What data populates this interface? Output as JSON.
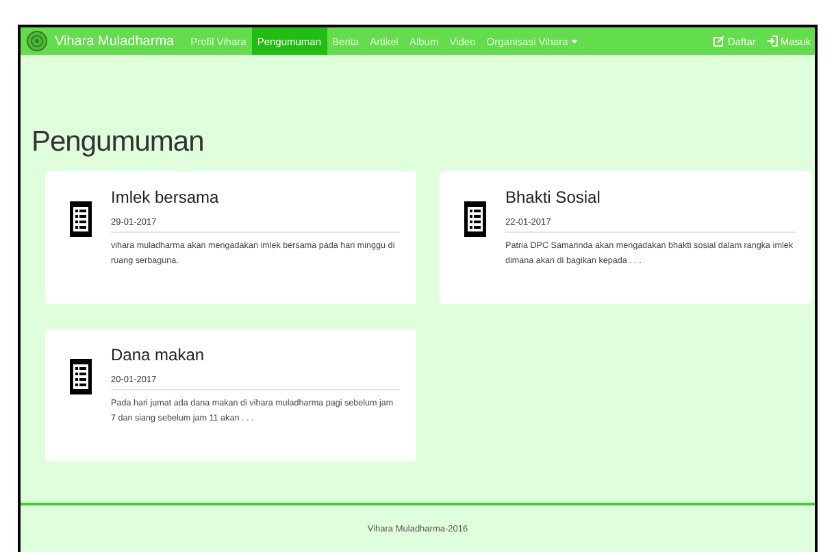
{
  "navbar": {
    "brand": "Vihara Muladharma",
    "items": [
      {
        "label": "Profil Vihara",
        "kind": "link",
        "selected": false
      },
      {
        "label": "Pengumuman",
        "kind": "link",
        "selected": true
      },
      {
        "label": "Berita",
        "kind": "link",
        "selected": false
      },
      {
        "label": "Artikel",
        "kind": "link",
        "selected": false
      },
      {
        "label": "Album",
        "kind": "link",
        "selected": false
      },
      {
        "label": "Video",
        "kind": "link",
        "selected": false
      },
      {
        "label": "Organisasi Vihara",
        "kind": "dropdown",
        "selected": false
      }
    ],
    "actions": [
      {
        "label": "Daftar",
        "kind": "register"
      },
      {
        "label": "Masuk",
        "kind": "login"
      }
    ]
  },
  "page_title": "Pengumuman",
  "announcements": [
    {
      "title": "Imlek bersama",
      "date": "29-01-2017",
      "excerpt": "vihara muladharma akan mengadakan imlek bersama pada hari minggu di ruang serbaguna."
    },
    {
      "title": "Bhakti Sosial",
      "date": "22-01-2017",
      "excerpt": "Patria DPC Samarinda akan mengadakan bhakti sosial dalam rangka imlek dimana akan di bagikan kepada . . ."
    },
    {
      "title": "Dana makan",
      "date": "20-01-2017",
      "excerpt": "Pada hari jumat ada dana makan di vihara muladharma pagi sebelum jam 7 dan siang sebelum jam 11 akan . . ."
    }
  ],
  "footer": "Vihara Muladharma-2016"
}
